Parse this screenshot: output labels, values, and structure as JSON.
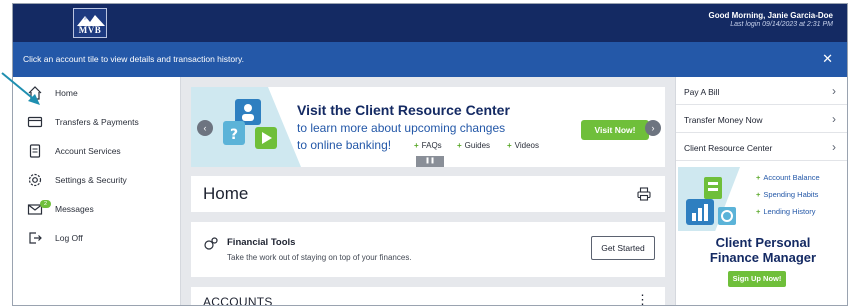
{
  "header": {
    "logo_text": "MVB",
    "greeting": "Good Morning, Janie Garcia-Doe",
    "last_login": "Last login 09/14/2023 at 2:31 PM"
  },
  "info_bar": {
    "message": "Click an account tile to view details and transaction history.",
    "close_symbol": "✕"
  },
  "sidebar": {
    "items": [
      {
        "label": "Home",
        "icon": "home-icon"
      },
      {
        "label": "Transfers & Payments",
        "icon": "card-icon"
      },
      {
        "label": "Account Services",
        "icon": "document-icon"
      },
      {
        "label": "Settings & Security",
        "icon": "gear-icon"
      },
      {
        "label": "Messages",
        "icon": "envelope-icon",
        "badge": "2"
      },
      {
        "label": "Log Off",
        "icon": "logout-icon"
      }
    ]
  },
  "banner": {
    "title": "Visit the Client Resource Center",
    "line1": "to learn more about upcoming changes",
    "line2": "to online banking!",
    "links": [
      "FAQs",
      "Guides",
      "Videos"
    ],
    "button": "Visit Now!",
    "prev_symbol": "‹",
    "next_symbol": "›",
    "pause_symbol": "❚❚"
  },
  "home": {
    "title": "Home"
  },
  "financial_tools": {
    "title": "Financial Tools",
    "description": "Take the work out of staying on top of your finances.",
    "button": "Get Started"
  },
  "accounts": {
    "title": "ACCOUNTS",
    "menu_symbol": "⋮"
  },
  "quick_links": [
    {
      "label": "Pay A Bill",
      "chevron": "›"
    },
    {
      "label": "Transfer Money Now",
      "chevron": "›"
    },
    {
      "label": "Client Resource Center",
      "chevron": "›"
    }
  ],
  "promo": {
    "items": [
      "Account Balance",
      "Spending Habits",
      "Lending History"
    ],
    "title_line1": "Client Personal",
    "title_line2": "Finance Manager",
    "button": "Sign Up Now!"
  },
  "colors": {
    "header_navy": "#142a63",
    "info_blue": "#2458a8",
    "accent_green": "#6fbf3a",
    "annotation_arrow": "#1f8fb0"
  }
}
